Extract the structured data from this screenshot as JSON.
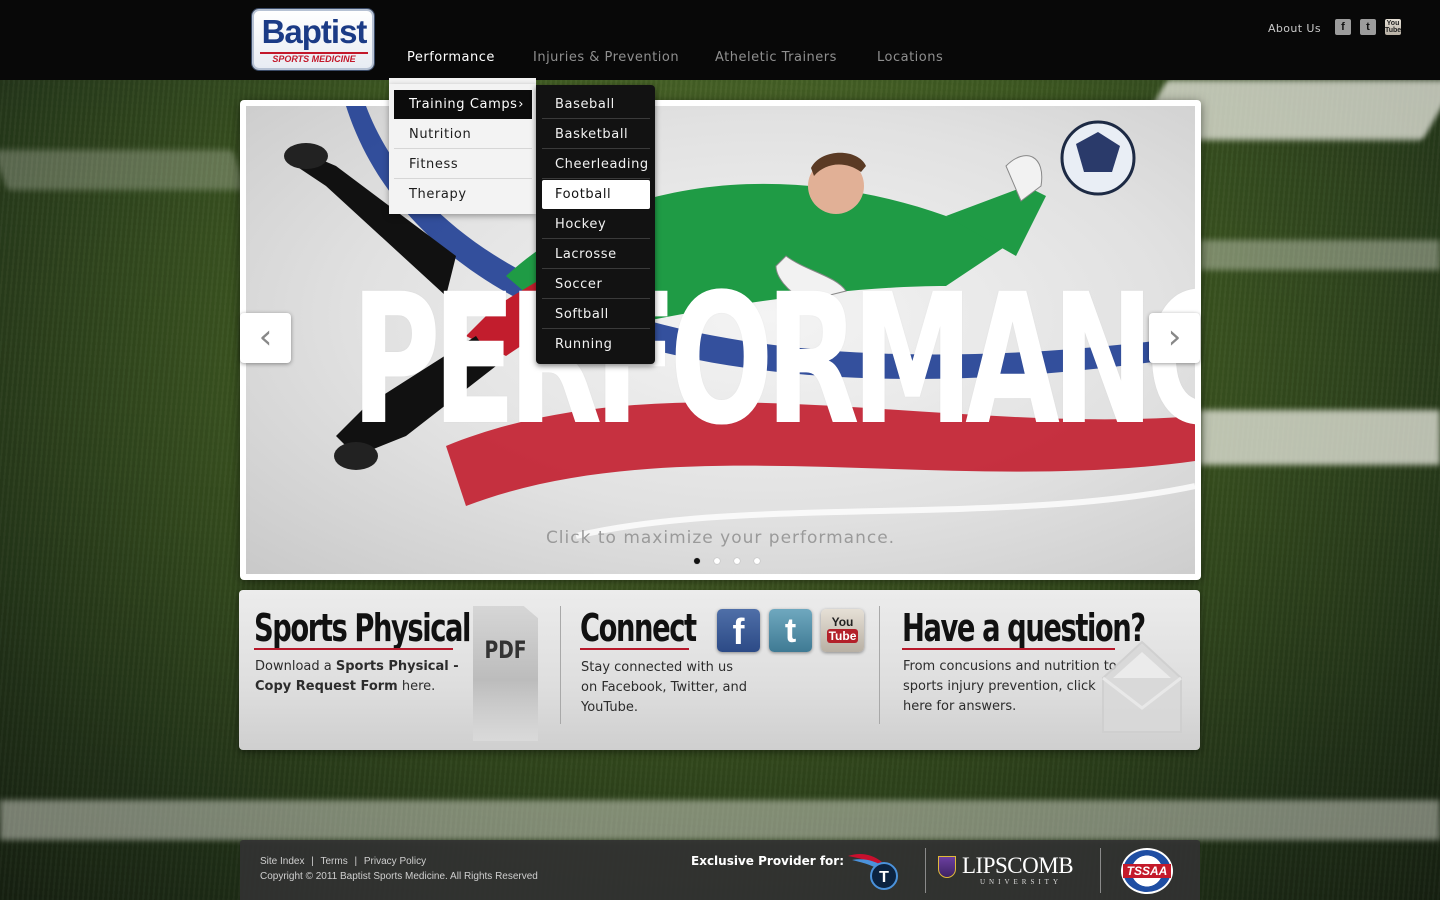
{
  "brand": {
    "name": "Baptist",
    "tagline": "SPORTS MEDICINE"
  },
  "nav": {
    "items": [
      {
        "label": "Performance",
        "active": true
      },
      {
        "label": "Injuries & Prevention",
        "active": false
      },
      {
        "label": "Atheletic Trainers",
        "active": false
      },
      {
        "label": "Locations",
        "active": false
      }
    ]
  },
  "header": {
    "about_label": "About Us",
    "social": [
      "facebook-icon",
      "twitter-icon",
      "youtube-icon"
    ],
    "social_glyphs": {
      "facebook": "f",
      "twitter": "t",
      "youtube_top": "You",
      "youtube_bottom": "Tube"
    }
  },
  "dropdown": {
    "level1": [
      {
        "label": "Training Camps",
        "selected": true
      },
      {
        "label": "Nutrition"
      },
      {
        "label": "Fitness"
      },
      {
        "label": "Therapy"
      }
    ],
    "level2": [
      {
        "label": "Baseball"
      },
      {
        "label": "Basketball"
      },
      {
        "label": "Cheerleading"
      },
      {
        "label": "Football",
        "selected": true
      },
      {
        "label": "Hockey"
      },
      {
        "label": "Lacrosse"
      },
      {
        "label": "Soccer"
      },
      {
        "label": "Softball"
      },
      {
        "label": "Running"
      }
    ]
  },
  "hero": {
    "word": "PERFORMANCE",
    "tagline": "Click to maximize your performance.",
    "slide_count": 4,
    "active_slide": 1,
    "prev_glyph": "‹",
    "next_glyph": "›"
  },
  "panel": {
    "physical": {
      "title": "Sports Physical",
      "text_prefix": "Download a ",
      "text_bold": "Sports Physical - Copy Request Form",
      "text_suffix": " here.",
      "pdf_label": "PDF"
    },
    "connect": {
      "title": "Connect",
      "text": "Stay connected with us on Facebook, Twitter, and YouTube."
    },
    "question": {
      "title": "Have a question?",
      "text": "From concusions and nutrition to sports injury prevention, click here for answers."
    }
  },
  "footer": {
    "links": [
      "Site Index",
      "Terms",
      "Privacy Policy"
    ],
    "separator": "|",
    "copyright": "Copyright © 2011 Baptist Sports Medicine. All Rights Reserved",
    "exclusive_label": "Exclusive Provider for:",
    "partners": {
      "lipscomb": "LIPSCOMB",
      "lipscomb_sub": "UNIVERSITY",
      "tssaa": "TSSAA"
    }
  },
  "colors": {
    "accent_red": "#b7182a",
    "brand_blue": "#1b3b86",
    "nav_bg": "#080808"
  }
}
